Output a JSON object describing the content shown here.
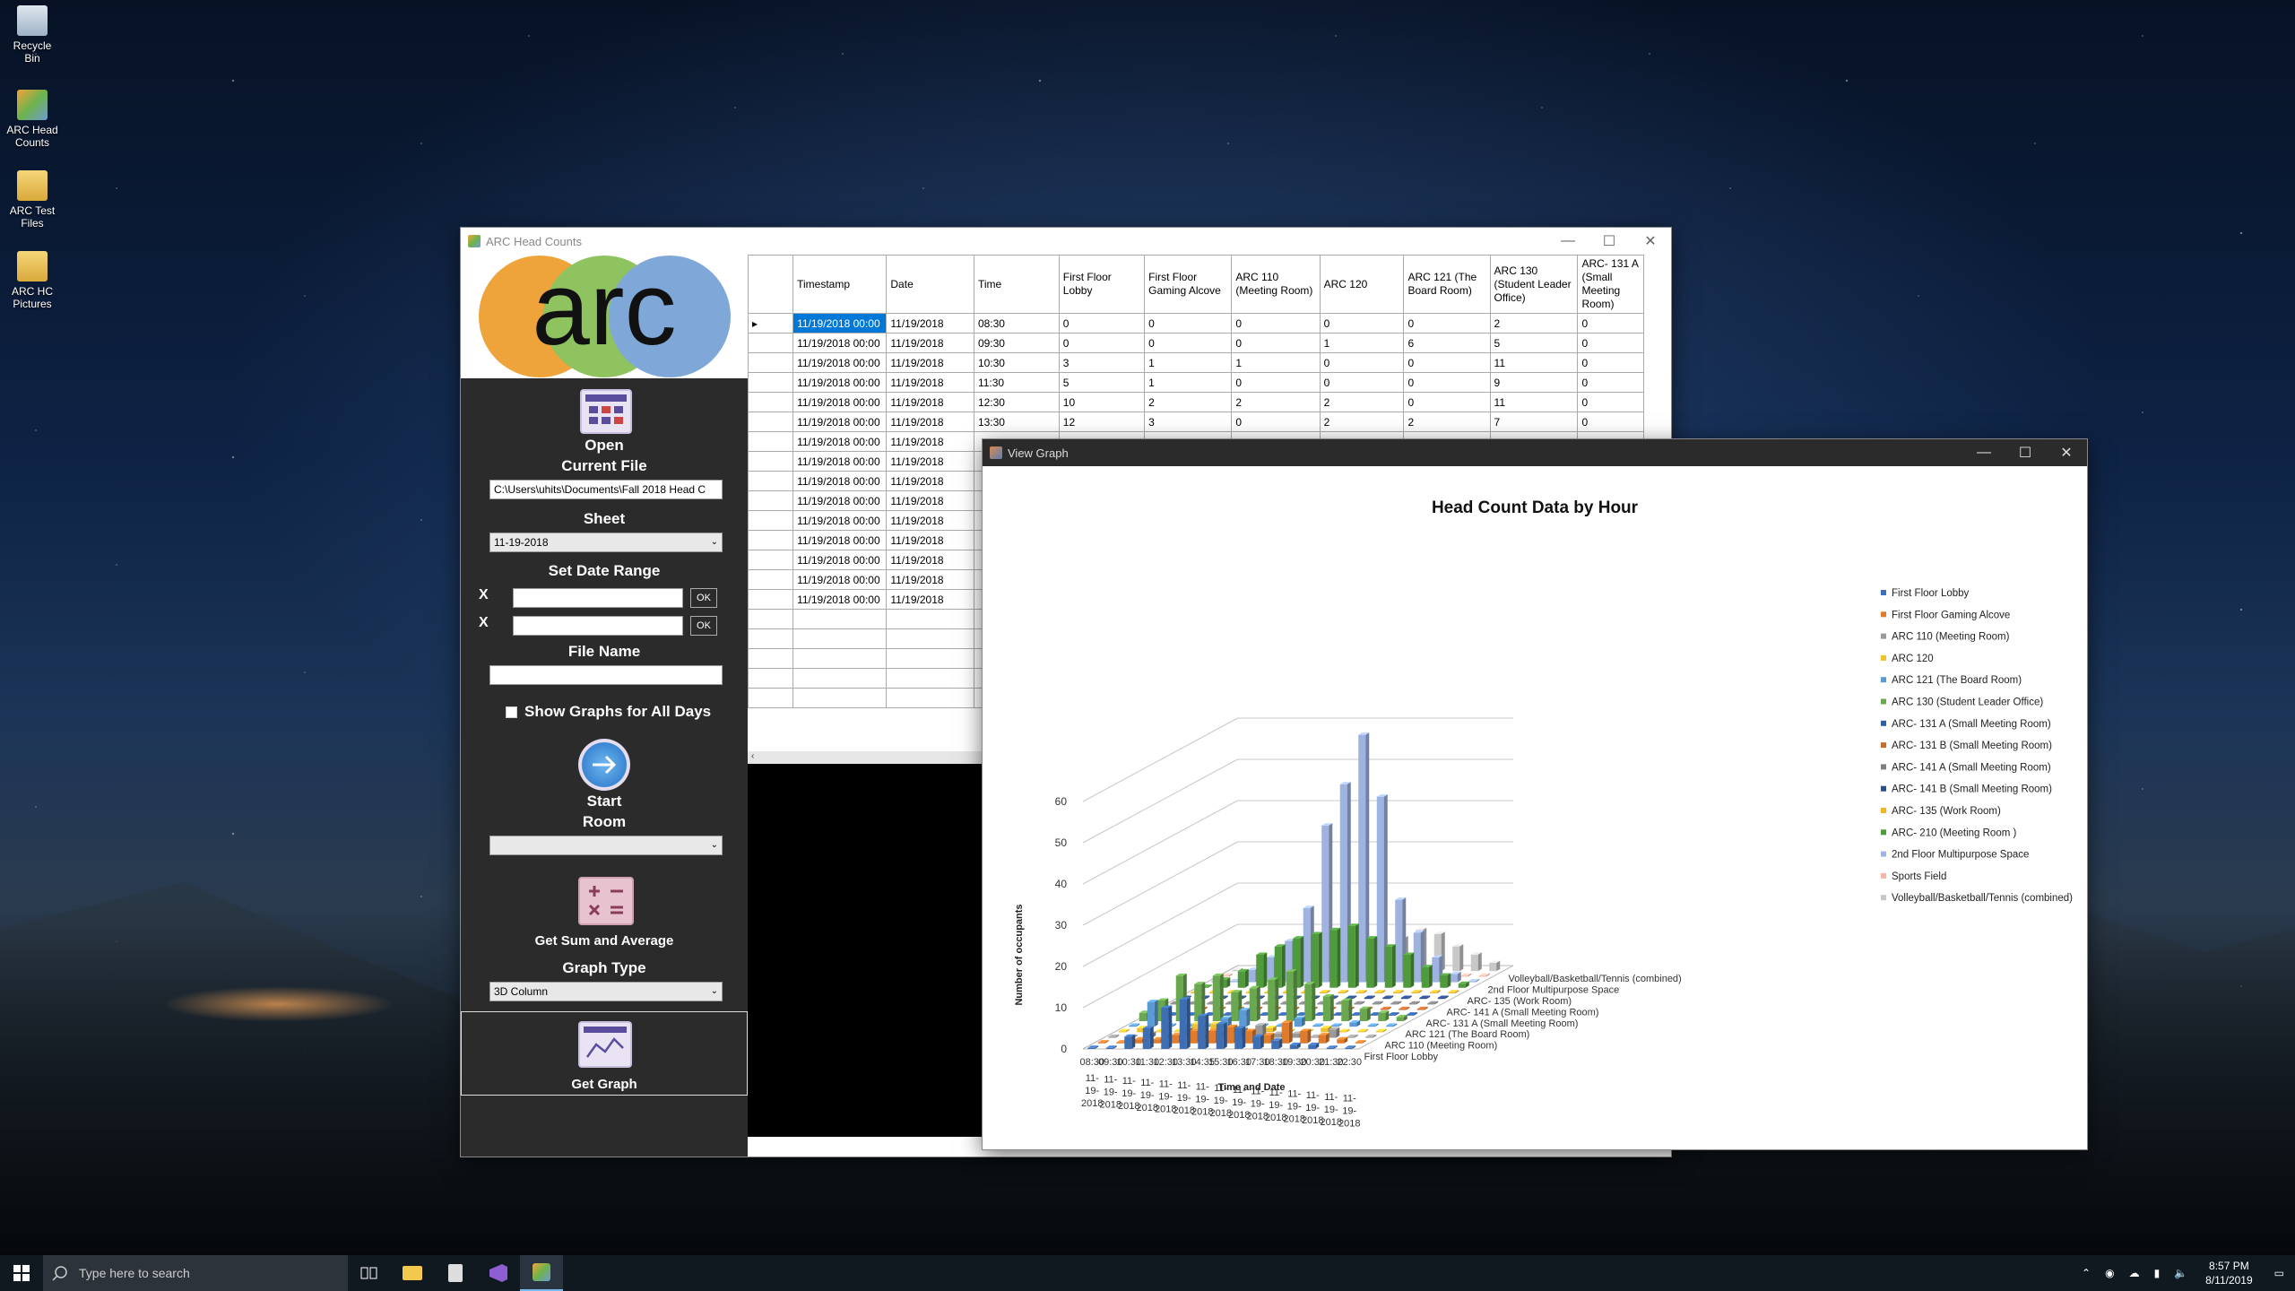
{
  "desktop": {
    "icons": [
      {
        "label": "Recycle Bin"
      },
      {
        "label": "ARC Head Counts"
      },
      {
        "label": "ARC Test Files"
      },
      {
        "label": "ARC HC Pictures"
      }
    ]
  },
  "main_window": {
    "title": "ARC Head Counts",
    "logo_text": "arc",
    "open_label": "Open",
    "current_file_label": "Current File",
    "current_file_value": "C:\\Users\\uhits\\Documents\\Fall 2018 Head C",
    "sheet_label": "Sheet",
    "sheet_value": "11-19-2018",
    "date_range_label": "Set Date Range",
    "x_label": "X",
    "ok_label": "OK",
    "file_name_label": "File Name",
    "show_graphs_label": "Show Graphs for All Days",
    "start_label": "Start",
    "room_label": "Room",
    "sum_avg_label": "Get Sum and Average",
    "graph_type_label": "Graph Type",
    "graph_type_value": "3D Column",
    "get_graph_label": "Get Graph"
  },
  "grid": {
    "columns": [
      "Timestamp",
      "Date",
      "Time",
      "First Floor Lobby",
      "First Floor Gaming Alcove",
      "ARC 110 (Meeting Room)",
      "ARC 120",
      "ARC 121 (The Board Room)",
      "ARC 130 (Student Leader Office)",
      "ARC- 131 A (Small Meeting Room)"
    ],
    "rows": [
      [
        "11/19/2018 00:00",
        "11/19/2018",
        "08:30",
        "0",
        "0",
        "0",
        "0",
        "0",
        "2",
        "0"
      ],
      [
        "11/19/2018 00:00",
        "11/19/2018",
        "09:30",
        "0",
        "0",
        "0",
        "1",
        "6",
        "5",
        "0"
      ],
      [
        "11/19/2018 00:00",
        "11/19/2018",
        "10:30",
        "3",
        "1",
        "1",
        "0",
        "0",
        "11",
        "0"
      ],
      [
        "11/19/2018 00:00",
        "11/19/2018",
        "11:30",
        "5",
        "1",
        "0",
        "0",
        "0",
        "9",
        "0"
      ],
      [
        "11/19/2018 00:00",
        "11/19/2018",
        "12:30",
        "10",
        "2",
        "2",
        "2",
        "0",
        "11",
        "0"
      ],
      [
        "11/19/2018 00:00",
        "11/19/2018",
        "13:30",
        "12",
        "3",
        "0",
        "2",
        "2",
        "7",
        "0"
      ],
      [
        "11/19/2018 00:00",
        "11/19/2018",
        "",
        "",
        "",
        "",
        "",
        "",
        "",
        ""
      ],
      [
        "11/19/2018 00:00",
        "11/19/2018",
        "",
        "",
        "",
        "",
        "",
        "",
        "",
        ""
      ],
      [
        "11/19/2018 00:00",
        "11/19/2018",
        "",
        "",
        "",
        "",
        "",
        "",
        "",
        ""
      ],
      [
        "11/19/2018 00:00",
        "11/19/2018",
        "",
        "",
        "",
        "",
        "",
        "",
        "",
        ""
      ],
      [
        "11/19/2018 00:00",
        "11/19/2018",
        "",
        "",
        "",
        "",
        "",
        "",
        "",
        ""
      ],
      [
        "11/19/2018 00:00",
        "11/19/2018",
        "",
        "",
        "",
        "",
        "",
        "",
        "",
        ""
      ],
      [
        "11/19/2018 00:00",
        "11/19/2018",
        "",
        "",
        "",
        "",
        "",
        "",
        "",
        ""
      ],
      [
        "11/19/2018 00:00",
        "11/19/2018",
        "",
        "",
        "",
        "",
        "",
        "",
        "",
        ""
      ],
      [
        "11/19/2018 00:00",
        "11/19/2018",
        "",
        "",
        "",
        "",
        "",
        "",
        "",
        ""
      ]
    ]
  },
  "graph_window": {
    "title": "View Graph"
  },
  "chart_data": {
    "type": "bar",
    "title": "Head Count Data by Hour",
    "xlabel": "Time and Date",
    "ylabel": "Number of occupants",
    "ylim": [
      0,
      60
    ],
    "yticks": [
      0,
      10,
      20,
      30,
      40,
      50,
      60
    ],
    "x_times": [
      "08:30",
      "09:30",
      "10:30",
      "11:30",
      "12:30",
      "13:30",
      "14:35",
      "15:30",
      "16:30",
      "17:30",
      "18:30",
      "19:30",
      "20:30",
      "21:30",
      "22:30"
    ],
    "x_date": "11-19-2018",
    "depth_labels": [
      "Volleyball/Basketball/Tennis (combined)",
      "2nd Floor Multipurpose Space",
      "ARC- 135 (Work Room)",
      "ARC- 141 A (Small Meeting Room)",
      "ARC- 131 A (Small Meeting Room)",
      "ARC 121 (The Board Room)",
      "ARC 110 (Meeting Room)",
      "First Floor Lobby"
    ],
    "legend_position": "right",
    "series": [
      {
        "name": "First Floor Lobby",
        "color": "#3e6fb5",
        "values": [
          0,
          0,
          3,
          5,
          10,
          12,
          8,
          6,
          5,
          3,
          2,
          1,
          1,
          0,
          0
        ]
      },
      {
        "name": "First Floor Gaming Alcove",
        "color": "#e07b2c",
        "values": [
          0,
          0,
          1,
          1,
          2,
          3,
          3,
          4,
          3,
          2,
          5,
          3,
          2,
          1,
          0
        ]
      },
      {
        "name": "ARC 110 (Meeting Room)",
        "color": "#9a9a9a",
        "values": [
          0,
          0,
          1,
          0,
          2,
          0,
          1,
          2,
          3,
          1,
          1,
          0,
          2,
          0,
          0
        ]
      },
      {
        "name": "ARC 120",
        "color": "#f2c02e",
        "values": [
          0,
          1,
          0,
          0,
          2,
          2,
          1,
          0,
          1,
          0,
          0,
          1,
          0,
          0,
          0
        ]
      },
      {
        "name": "ARC 121 (The Board Room)",
        "color": "#5a9bd5",
        "values": [
          0,
          6,
          0,
          0,
          0,
          2,
          4,
          0,
          0,
          2,
          0,
          0,
          1,
          0,
          0
        ]
      },
      {
        "name": "ARC 130 (Student Leader Office)",
        "color": "#6aa84f",
        "values": [
          2,
          5,
          11,
          9,
          11,
          7,
          8,
          10,
          12,
          9,
          6,
          5,
          3,
          2,
          1
        ]
      },
      {
        "name": "ARC- 131 A (Small Meeting Room)",
        "color": "#2f5fa8",
        "values": [
          0,
          0,
          0,
          0,
          0,
          0,
          0,
          0,
          0,
          0,
          0,
          0,
          0,
          0,
          0
        ]
      },
      {
        "name": "ARC- 131 B (Small Meeting Room)",
        "color": "#c96b2c",
        "values": [
          0,
          0,
          0,
          0,
          0,
          0,
          0,
          0,
          0,
          0,
          0,
          0,
          0,
          0,
          0
        ]
      },
      {
        "name": "ARC- 141 A (Small Meeting Room)",
        "color": "#7f7f7f",
        "values": [
          0,
          0,
          0,
          0,
          0,
          0,
          0,
          0,
          0,
          0,
          0,
          0,
          0,
          0,
          0
        ]
      },
      {
        "name": "ARC- 141 B (Small Meeting Room)",
        "color": "#2e4e8c",
        "values": [
          0,
          0,
          0,
          0,
          0,
          0,
          0,
          0,
          0,
          0,
          0,
          0,
          0,
          0,
          0
        ]
      },
      {
        "name": "ARC- 135 (Work Room)",
        "color": "#f0b429",
        "values": [
          0,
          0,
          0,
          0,
          0,
          0,
          0,
          0,
          0,
          0,
          0,
          0,
          0,
          0,
          0
        ]
      },
      {
        "name": "ARC- 210 (Meeting Room )",
        "color": "#4f9a3a",
        "values": [
          0,
          2,
          4,
          8,
          10,
          12,
          13,
          14,
          15,
          12,
          10,
          8,
          5,
          3,
          1
        ]
      },
      {
        "name": "2nd Floor Multipurpose Space",
        "color": "#9fb3e0",
        "values": [
          0,
          0,
          3,
          6,
          10,
          18,
          38,
          48,
          60,
          45,
          20,
          12,
          6,
          2,
          0
        ]
      },
      {
        "name": "Sports Field",
        "color": "#f4b6a6",
        "values": [
          0,
          0,
          0,
          0,
          0,
          0,
          0,
          0,
          0,
          0,
          0,
          0,
          0,
          0,
          0
        ]
      },
      {
        "name": "Volleyball/Basketball/Tennis (combined)",
        "color": "#c8c8c8",
        "values": [
          0,
          0,
          0,
          1,
          2,
          3,
          4,
          5,
          6,
          8,
          10,
          9,
          6,
          4,
          2
        ]
      }
    ]
  },
  "taskbar": {
    "search_placeholder": "Type here to search",
    "time": "8:57 PM",
    "date": "8/11/2019"
  }
}
